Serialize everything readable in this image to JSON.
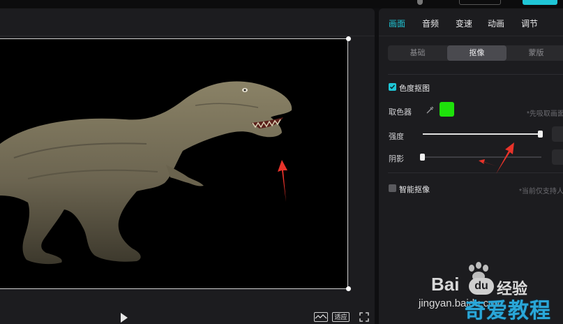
{
  "tabs": [
    {
      "label": "画面"
    },
    {
      "label": "音频"
    },
    {
      "label": "变速"
    },
    {
      "label": "动画"
    },
    {
      "label": "调节"
    }
  ],
  "subtabs": [
    {
      "label": "基础"
    },
    {
      "label": "抠像"
    },
    {
      "label": "蒙版"
    }
  ],
  "chroma_key": {
    "label": "色度抠图",
    "enabled": true,
    "picker_label": "取色器",
    "picker_color": "#1ee10b",
    "picker_hint": "*先吸取画面",
    "intensity_label": "强度",
    "intensity_level": 0.99,
    "shadow_label": "阴影",
    "shadow_level": 0.0
  },
  "smart_cutout": {
    "label": "智能抠像",
    "enabled": false,
    "hint": "*当前仅支持人"
  },
  "preview_footer": {
    "fit_label": "适应"
  },
  "watermark": {
    "brand": "Bai",
    "brand_tail": "经验",
    "url": "jingyan.baidu.com",
    "stamp": "奇爱教程"
  },
  "colors": {
    "accent": "#1fc6d6",
    "panel": "#1c1c1f",
    "canvas": "#000000",
    "arrow": "#e8332a"
  }
}
